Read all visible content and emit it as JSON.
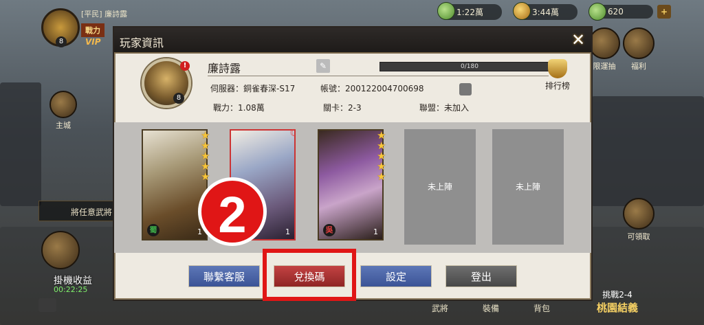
{
  "top_resources": [
    {
      "icon": "jade-icon",
      "value": "1:22萬"
    },
    {
      "icon": "coin-icon",
      "value": "3:44萬"
    },
    {
      "icon": "gem-icon",
      "value": "620"
    }
  ],
  "player_hud": {
    "rank": "[平民]",
    "name": "廉詩露",
    "power_label": "戰力",
    "vip": "VIP",
    "level": "8"
  },
  "side_icons": {
    "lucky_draw": "限運抽",
    "welfare": "福利",
    "main_city": "主城",
    "claim": "可領取"
  },
  "left_widgets": {
    "tip_text": "將任意武將",
    "idle_label": "掛機收益",
    "idle_time": "00:22:25"
  },
  "bottom_tabs": [
    "武將",
    "裝備",
    "背包"
  ],
  "stage": {
    "label": "挑戰2-4",
    "name": "桃園結義"
  },
  "modal": {
    "title": "玩家資訊",
    "player": {
      "name": "廉詩露",
      "level": "8",
      "exp": "0/180",
      "server_label": "伺服器：",
      "server": "銅雀春深-S17",
      "account_label": "帳號：",
      "account": "200122004700698",
      "power_label": "戰力：",
      "power": "1.08萬",
      "stage_label": "關卡：",
      "stage": "2-3",
      "alliance_label": "聯盟：",
      "alliance": "未加入"
    },
    "rank_button": "排行榜",
    "team": [
      {
        "faction": "蜀",
        "faction_color": "#3fb34a",
        "count": "1",
        "stars": 5
      },
      {
        "faction": "",
        "faction_color": "#e24040",
        "count": "1",
        "stars": 0
      },
      {
        "faction": "吳",
        "faction_color": "#e24040",
        "count": "1",
        "stars": 5
      }
    ],
    "empty_slot_label": "未上陣",
    "buttons": {
      "contact": "聯繫客服",
      "redeem": "兌換碼",
      "settings": "設定",
      "logout": "登出"
    }
  },
  "annotation": {
    "step": "2"
  },
  "colors": {
    "highlight": "#e01616",
    "blue_button": "#4a63a6",
    "red_button": "#a83030",
    "gray_button": "#5a5a5a"
  }
}
